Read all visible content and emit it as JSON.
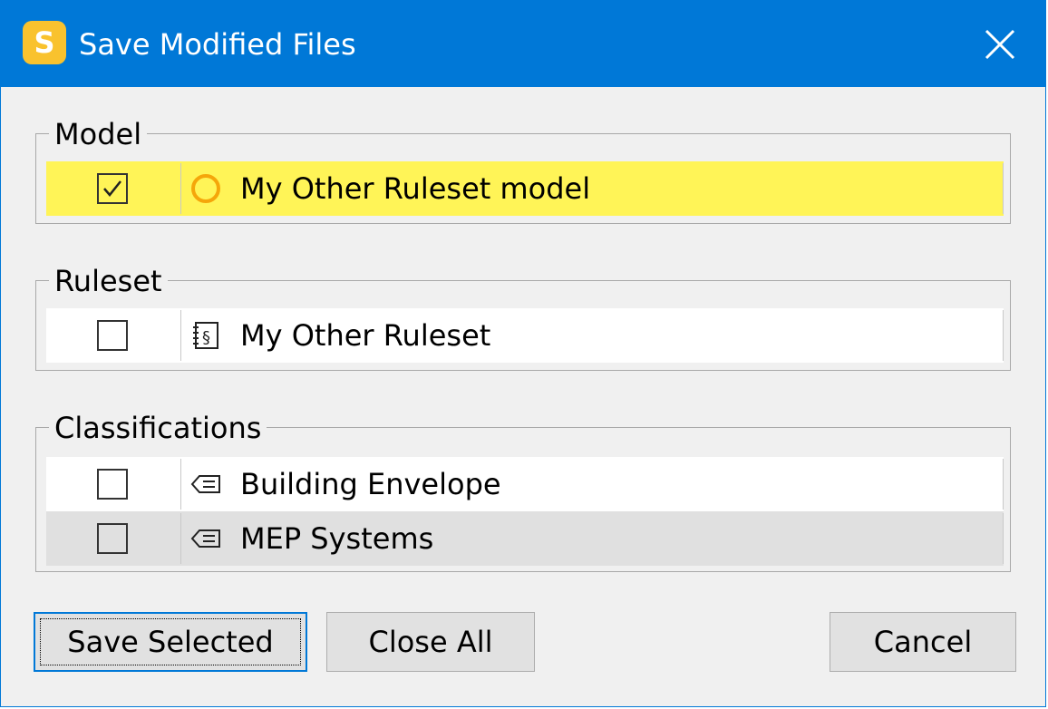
{
  "window": {
    "app_icon_letter": "S",
    "title": "Save Modified Files",
    "close_icon": "close-icon",
    "accent_color": "#0078d7"
  },
  "groups": {
    "model": {
      "label": "Model",
      "items": [
        {
          "label": "My Other Ruleset model",
          "checked": true,
          "icon": "model-circle-icon",
          "highlight_color": "#fff457"
        }
      ]
    },
    "ruleset": {
      "label": "Ruleset",
      "items": [
        {
          "label": "My Other Ruleset",
          "checked": false,
          "icon": "ruleset-book-icon"
        }
      ]
    },
    "classifications": {
      "label": "Classifications",
      "items": [
        {
          "label": "Building Envelope",
          "checked": false,
          "icon": "classification-tag-icon"
        },
        {
          "label": "MEP Systems",
          "checked": false,
          "icon": "classification-tag-icon"
        }
      ]
    }
  },
  "buttons": {
    "save_selected": "Save Selected",
    "close_all": "Close All",
    "cancel": "Cancel"
  }
}
